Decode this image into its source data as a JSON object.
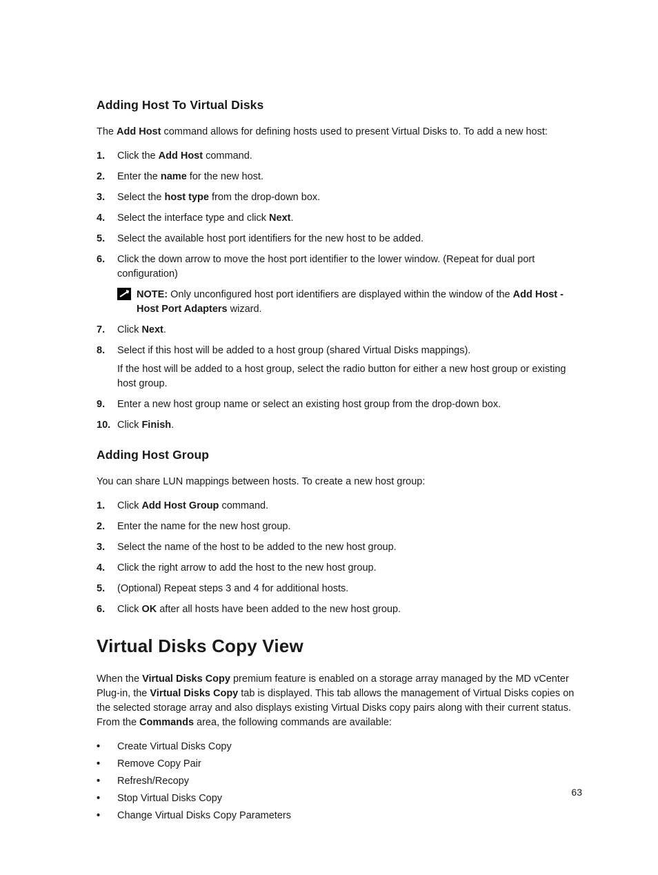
{
  "pageNumber": "63",
  "section1": {
    "heading": "Adding Host To Virtual Disks",
    "intro": {
      "pre": "The ",
      "bold": "Add Host",
      "post": " command allows for defining hosts used to present Virtual Disks to. To add a new host:"
    },
    "steps": [
      {
        "n": "1.",
        "t1": "Click the ",
        "b": "Add Host",
        "t2": " command."
      },
      {
        "n": "2.",
        "t1": "Enter the ",
        "b": "name",
        "t2": " for the new host."
      },
      {
        "n": "3.",
        "t1": "Select the ",
        "b": "host type",
        "t2": " from the drop-down box."
      },
      {
        "n": "4.",
        "t1": "Select the interface type and click ",
        "b": "Next",
        "t2": "."
      },
      {
        "n": "5.",
        "t1": "Select the available host port identifiers for the new host to be added.",
        "b": "",
        "t2": ""
      },
      {
        "n": "6.",
        "t1": "Click the down arrow to move the host port identifier to the lower window. (Repeat for dual port configuration)",
        "b": "",
        "t2": "",
        "note": {
          "label": "NOTE:",
          "t1": " Only unconfigured host port identifiers are displayed within the window of the ",
          "b1": "Add Host - Host Port Adapters",
          "t2": " wizard."
        }
      },
      {
        "n": "7.",
        "t1": "Click ",
        "b": "Next",
        "t2": "."
      },
      {
        "n": "8.",
        "t1": "Select if this host will be added to a host group (shared Virtual Disks mappings).",
        "b": "",
        "t2": "",
        "sub": "If the host will be added to a host group, select the radio button for either a new host group or existing host group."
      },
      {
        "n": "9.",
        "t1": "Enter a new host group name or select an existing host group from the drop-down box.",
        "b": "",
        "t2": ""
      },
      {
        "n": "10.",
        "t1": "Click ",
        "b": "Finish",
        "t2": "."
      }
    ]
  },
  "section2": {
    "heading": "Adding Host Group",
    "intro": "You can share LUN mappings between hosts. To create a new host group:",
    "steps": [
      {
        "n": "1.",
        "t1": "Click ",
        "b": "Add Host Group",
        "t2": " command."
      },
      {
        "n": "2.",
        "t1": "Enter the name for the new host group.",
        "b": "",
        "t2": ""
      },
      {
        "n": "3.",
        "t1": "Select the name of the host to be added to the new host group.",
        "b": "",
        "t2": ""
      },
      {
        "n": "4.",
        "t1": "Click the right arrow to add the host to the new host group.",
        "b": "",
        "t2": ""
      },
      {
        "n": "5.",
        "t1": "(Optional) Repeat steps 3 and 4 for additional hosts.",
        "b": "",
        "t2": ""
      },
      {
        "n": "6.",
        "t1": "Click ",
        "b": "OK",
        "t2": " after all hosts have been added to the new host group."
      }
    ]
  },
  "section3": {
    "heading": "Virtual Disks Copy View",
    "para": {
      "t1": "When the ",
      "b1": "Virtual Disks Copy",
      "t2": " premium feature is enabled on a storage array managed by the MD vCenter Plug-in, the ",
      "b2": "Virtual Disks Copy",
      "t3": " tab is displayed. This tab allows the management of Virtual Disks copies on the selected storage array and also displays existing Virtual Disks copy pairs along with their current status. From the ",
      "b3": "Commands",
      "t4": " area, the following commands are available:"
    },
    "bullets": [
      "Create Virtual Disks Copy",
      "Remove Copy Pair",
      "Refresh/Recopy",
      "Stop Virtual Disks Copy",
      "Change Virtual Disks Copy Parameters"
    ]
  }
}
